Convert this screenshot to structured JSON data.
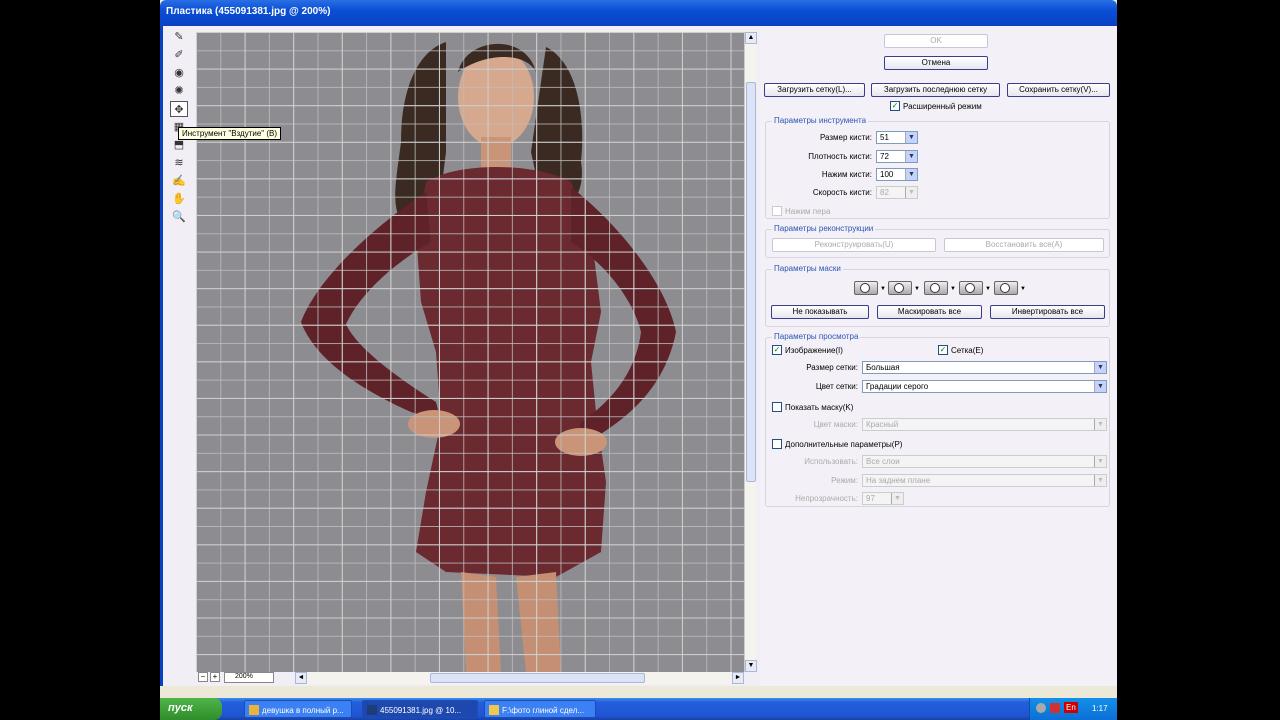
{
  "window": {
    "title": "Пластика (455091381.jpg @ 200%)"
  },
  "tools": [
    {
      "name": "warp-icon",
      "glyph": "✎"
    },
    {
      "name": "reconstruct-icon",
      "glyph": "✐"
    },
    {
      "name": "twirl-icon",
      "glyph": "◉"
    },
    {
      "name": "pucker-icon",
      "glyph": "✺"
    },
    {
      "name": "bloat-icon",
      "glyph": "✥"
    },
    {
      "name": "push-left-icon",
      "glyph": "▦"
    },
    {
      "name": "mirror-icon",
      "glyph": "⬒"
    },
    {
      "name": "turbulence-icon",
      "glyph": "≋"
    },
    {
      "name": "freeze-mask-icon",
      "glyph": "✍"
    },
    {
      "name": "hand-icon",
      "glyph": "✋"
    },
    {
      "name": "zoom-icon",
      "glyph": "🔍"
    }
  ],
  "tooltip": "Инструмент \"Вздутие\" (B)",
  "zoom": {
    "value": "200%",
    "minus": "−",
    "plus": "+"
  },
  "buttons": {
    "ok": "OK",
    "cancel": "Отмена",
    "load_mesh": "Загрузить сетку(L)...",
    "load_last_mesh": "Загрузить последнюю сетку",
    "save_mesh": "Сохранить сетку(V)..."
  },
  "advanced_mode": "Расширенный режим",
  "tool_options": {
    "title": "Параметры инструмента",
    "brush_size_label": "Размер кисти:",
    "brush_size": "51",
    "brush_density_label": "Плотность кисти:",
    "brush_density": "72",
    "brush_pressure_label": "Нажим кисти:",
    "brush_pressure": "100",
    "brush_rate_label": "Скорость кисти:",
    "brush_rate": "82",
    "stylus_pressure": "Нажим пера"
  },
  "reconstruct": {
    "title": "Параметры реконструкции",
    "reconstruct_btn": "Реконструировать(U)",
    "restore_all_btn": "Восстановить все(A)"
  },
  "mask": {
    "title": "Параметры маски",
    "none_btn": "Не показывать",
    "mask_all_btn": "Маскировать все",
    "invert_all_btn": "Инвертировать все"
  },
  "view": {
    "title": "Параметры просмотра",
    "image_label": "Изображение(I)",
    "mesh_label": "Сетка(E)",
    "mesh_size_label": "Размер сетки:",
    "mesh_size": "Большая",
    "mesh_color_label": "Цвет сетки:",
    "mesh_color": "Градации серого",
    "show_mask_label": "Показать маску(K)",
    "mask_color_label": "Цвет маски:",
    "mask_color": "Красный",
    "backdrop_label": "Дополнительные параметры(P)",
    "use_label": "Использовать:",
    "use_value": "Все слои",
    "mode_label": "Режим:",
    "mode_value": "На заднем плане",
    "opacity_label": "Непрозрачность:",
    "opacity_value": "97"
  },
  "taskbar": {
    "start": "пуск",
    "tasks": [
      {
        "label": "девушка в полный р...",
        "icon_color": "#e8b53a"
      },
      {
        "label": "455091381.jpg @ 10...",
        "icon_color": "#1c3d7a",
        "active": true
      },
      {
        "label": "F:\\фото глиной сдел...",
        "icon_color": "#f0c94c"
      }
    ],
    "lang": "En",
    "clock": "1:17"
  },
  "colors": {
    "accent": "#0841c4",
    "group_title": "#2b55b5",
    "dress": "#6a2a30"
  }
}
